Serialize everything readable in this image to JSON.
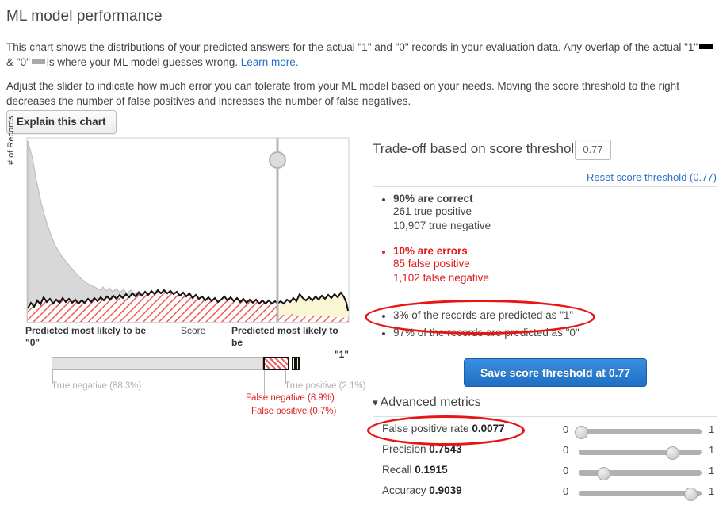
{
  "page": {
    "title": "ML model performance",
    "intro_paragraph_1_part1": "This chart shows the distributions of your predicted answers for the actual \"1\" and \"0\" records in your evaluation data. Any overlap of the actual \"1\"",
    "intro_paragraph_1_part2": "&",
    "intro_paragraph_1_part3": "\"0\"",
    "intro_paragraph_1_part4": "is where your ML model guesses wrong.",
    "learn_more_label": "Learn more.",
    "intro_paragraph_2": "Adjust the slider to indicate how much error you can tolerate from your ML model based on your needs. Moving the score threshold to the right decreases the number of false positives and increases the number of false negatives.",
    "explain_button": "Explain this chart"
  },
  "chart": {
    "ylabel": "# of Records",
    "xlabel_left": "Predicted most likely to be \"0\"",
    "xlabel_left_line1": "Predicted most likely to be",
    "xlabel_left_line2": "\"0\"",
    "xlabel_center": "Score",
    "xlabel_right_line1": "Predicted most likely to be",
    "xlabel_right_line2": "\"1\"",
    "threshold_position_pct": 79
  },
  "chart_data": {
    "type": "area",
    "title": "ML model performance",
    "xlabel": "Score",
    "ylabel": "# of Records",
    "xlim": [
      0,
      1
    ],
    "grid": false,
    "legend": [
      "actual \"1\"",
      "actual \"0\""
    ],
    "threshold": 0.77,
    "series": [
      {
        "name": "actual \"0\" distribution",
        "color": "#d0d0d0",
        "values": [
          100,
          78,
          60,
          48,
          40,
          34,
          30,
          27,
          25,
          23,
          21,
          20,
          19,
          18,
          18,
          17,
          17,
          16,
          16,
          15,
          15,
          14,
          14,
          14,
          13,
          13,
          12,
          12,
          12,
          11,
          11,
          11,
          10,
          10,
          10,
          9,
          9,
          9,
          8,
          8,
          8,
          7,
          7,
          7,
          7,
          6,
          6,
          6,
          6,
          5
        ]
      },
      {
        "name": "actual \"1\" distribution",
        "color": "#ffffff",
        "values": [
          7,
          8,
          9,
          7,
          8,
          9,
          8,
          7,
          8,
          8,
          9,
          8,
          9,
          9,
          10,
          9,
          10,
          11,
          10,
          11,
          10,
          9,
          10,
          9,
          8,
          9,
          8,
          9,
          8,
          9,
          9,
          10,
          9,
          10,
          9,
          8,
          9,
          8,
          9,
          10,
          9,
          10,
          11,
          10,
          11,
          10,
          11,
          12,
          11,
          8
        ]
      }
    ]
  },
  "segment_bar": {
    "segments": [
      {
        "name": "true negative",
        "label": "True negative (88.3%)",
        "pct": 88.3,
        "style": "gray"
      },
      {
        "name": "false negative",
        "label": "False negative (8.9%)",
        "pct": 8.9,
        "style": "hatch-red"
      },
      {
        "name": "false positive",
        "label": "False positive (0.7%)",
        "pct": 0.7,
        "style": "yellow"
      },
      {
        "name": "true positive",
        "label": "True positive (2.1%)",
        "pct": 2.1,
        "style": "yellow"
      }
    ]
  },
  "tradeoff": {
    "heading": "Trade-off based on score threshold",
    "threshold_value": "0.77",
    "reset_link": "Reset score threshold (0.77)",
    "correct": {
      "headline": "90% are correct",
      "line1": "261 true positive",
      "line2": "10,907 true negative"
    },
    "errors": {
      "headline": "10% are errors",
      "line1": "85 false positive",
      "line2": "1,102 false negative"
    },
    "predicted": [
      "3% of the records are predicted as \"1\"",
      "97% of the records are predicted as \"0\""
    ],
    "save_button": "Save score threshold at 0.77"
  },
  "advanced": {
    "heading": "Advanced metrics",
    "chevron": "⌄",
    "min_label": "0",
    "max_label": "1",
    "rows": [
      {
        "name": "False positive rate",
        "value": "0.0077",
        "fraction": 0.0077
      },
      {
        "name": "Precision",
        "value": "0.7543",
        "fraction": 0.7543
      },
      {
        "name": "Recall",
        "value": "0.1915",
        "fraction": 0.1915
      },
      {
        "name": "Accuracy",
        "value": "0.9039",
        "fraction": 0.9039
      }
    ]
  },
  "colors": {
    "accent_blue": "#2a6fc9",
    "error_red": "#e01b1b",
    "annotation_red": "#e81515",
    "button_blue": "#1f6fc4"
  }
}
